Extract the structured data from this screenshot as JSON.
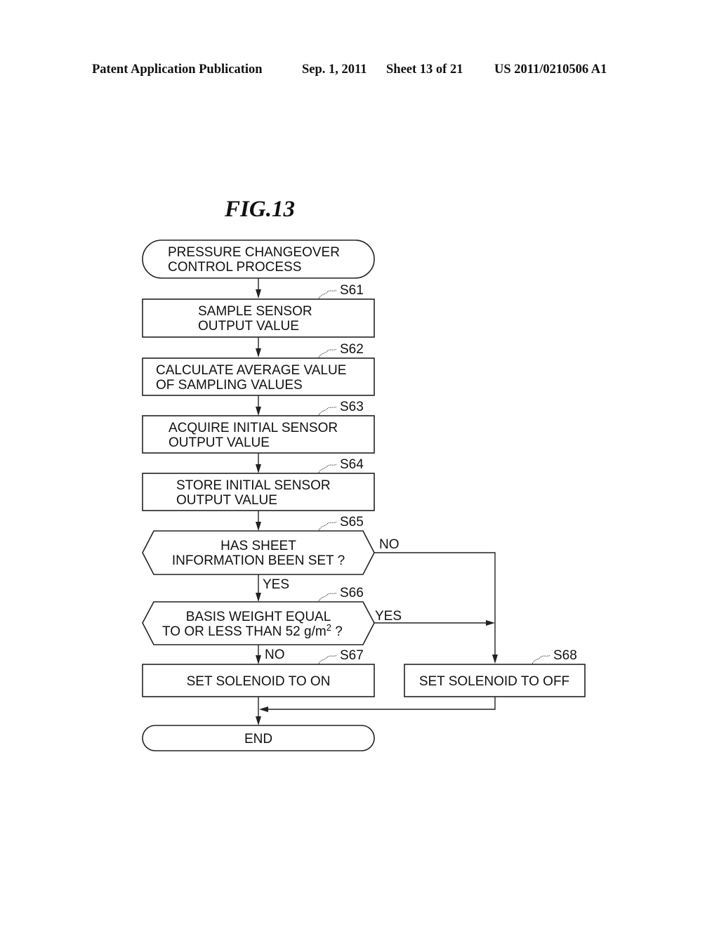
{
  "header": {
    "publication": "Patent Application Publication",
    "date": "Sep. 1, 2011",
    "sheet": "Sheet 13 of 21",
    "number": "US 2011/0210506 A1"
  },
  "figure": {
    "title": "FIG.13",
    "start": {
      "lines": [
        "PRESSURE CHANGEOVER",
        "CONTROL PROCESS"
      ]
    },
    "steps": [
      {
        "id": "S61",
        "lines": [
          "SAMPLE SENSOR",
          "OUTPUT VALUE"
        ]
      },
      {
        "id": "S62",
        "lines": [
          "CALCULATE AVERAGE VALUE",
          "OF SAMPLING VALUES"
        ]
      },
      {
        "id": "S63",
        "lines": [
          "ACQUIRE INITIAL SENSOR",
          "OUTPUT VALUE"
        ]
      },
      {
        "id": "S64",
        "lines": [
          "STORE INITIAL SENSOR",
          "OUTPUT VALUE"
        ]
      }
    ],
    "decisions": [
      {
        "id": "S65",
        "lines": [
          "HAS SHEET",
          "INFORMATION BEEN SET ?"
        ],
        "yes": "YES",
        "no": "NO"
      },
      {
        "id": "S66",
        "lines": [
          "BASIS WEIGHT EQUAL",
          "TO OR LESS THAN 52 g/m",
          "2",
          " ?"
        ],
        "yes": "YES",
        "no": "NO"
      }
    ],
    "actions": [
      {
        "id": "S67",
        "label": "SET SOLENOID TO ON"
      },
      {
        "id": "S68",
        "label": "SET SOLENOID TO OFF"
      }
    ],
    "end": {
      "label": "END"
    }
  }
}
